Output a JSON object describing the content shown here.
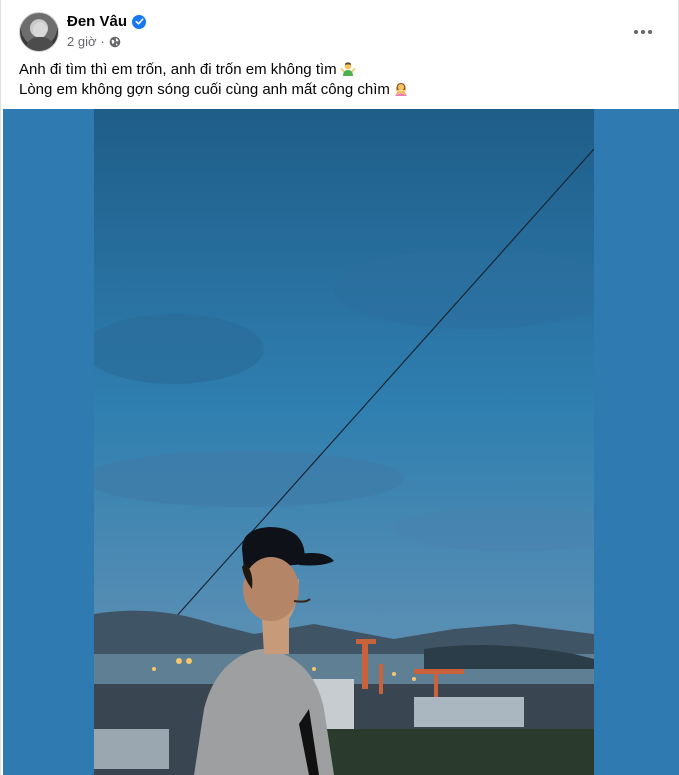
{
  "post": {
    "author": "Đen Vâu",
    "verified": true,
    "time": "2 giờ",
    "audience_icon": "globe-icon",
    "more_icon": "more-options-icon",
    "text_lines": [
      "Anh đi tìm thì em trốn, anh đi trốn em không tìm",
      "Lòng em không gợn sóng cuối cùng anh mất công chìm"
    ],
    "line_emojis": [
      "man-shrugging-emoji",
      "woman-gesturing-no-emoji"
    ]
  },
  "photo": {
    "alt_icon": "post-photo",
    "backdrop_color": "#2f7ab0"
  },
  "colors": {
    "brand": "#1877f2",
    "text_primary": "#050505",
    "text_secondary": "#65676b"
  }
}
